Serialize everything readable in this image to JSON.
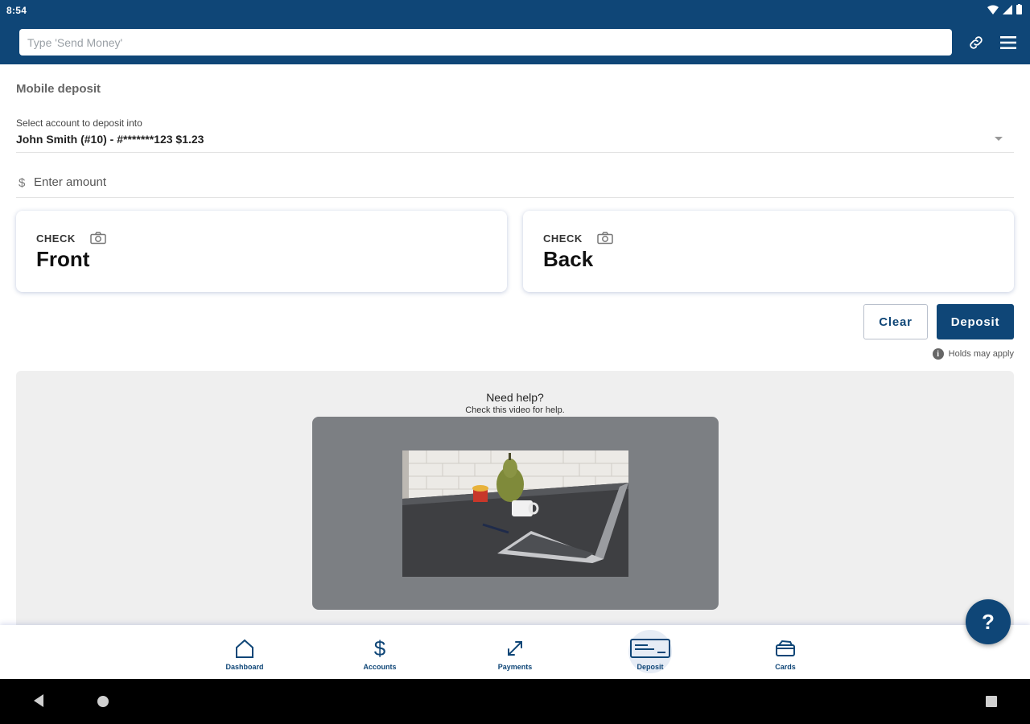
{
  "status_bar": {
    "time": "8:54"
  },
  "header": {
    "search_placeholder": "Type 'Send Money'"
  },
  "page": {
    "title": "Mobile deposit"
  },
  "account": {
    "label": "Select account to deposit into",
    "value": "John Smith (#10) - #*******123 $1.23"
  },
  "amount": {
    "currency_symbol": "$",
    "placeholder": "Enter amount"
  },
  "check_front": {
    "small_label": "CHECK",
    "big_label": "Front"
  },
  "check_back": {
    "small_label": "CHECK",
    "big_label": "Back"
  },
  "actions": {
    "clear_label": "Clear",
    "deposit_label": "Deposit",
    "holds_note": "Holds may apply"
  },
  "help": {
    "title": "Need help?",
    "subtitle": "Check this video for help."
  },
  "fab": {
    "label": "?"
  },
  "bottom_nav": [
    {
      "label": "Dashboard",
      "icon": "home-icon"
    },
    {
      "label": "Accounts",
      "icon": "dollar-icon"
    },
    {
      "label": "Payments",
      "icon": "transfer-arrows-icon"
    },
    {
      "label": "Deposit",
      "icon": "check-deposit-icon",
      "active": true
    },
    {
      "label": "Cards",
      "icon": "cards-icon"
    }
  ],
  "colors": {
    "brand": "#0f4677",
    "panel": "#efefef",
    "video_frame": "#7c7f83"
  }
}
